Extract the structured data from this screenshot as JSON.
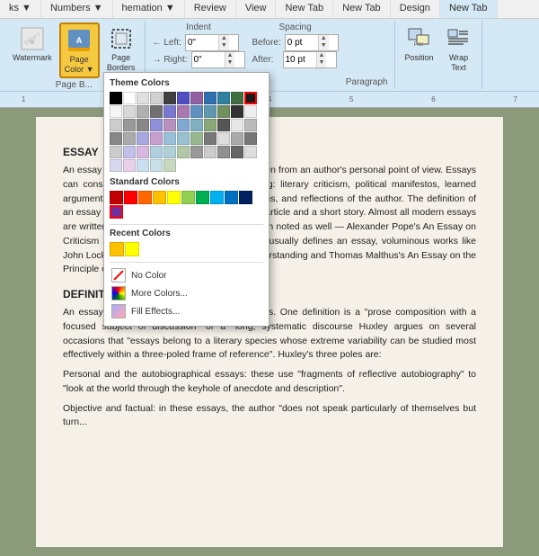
{
  "tabs": [
    "ks ▼",
    "Numbers ▼",
    "hemation ▼",
    "Review",
    "View",
    "New Tab",
    "New Tab",
    "Design",
    "New Tab"
  ],
  "ribbon": {
    "groups": {
      "page_bg": {
        "label": "Page B...",
        "buttons": [
          "Watermark",
          "Page\nColor",
          "Page\nBorders"
        ]
      },
      "paragraph": {
        "label": "Paragraph",
        "indent": {
          "label": "Indent",
          "left_label": "← Left:",
          "left_value": "0\"",
          "right_label": "→ Right:",
          "right_value": "0\""
        },
        "spacing": {
          "label": "Spacing",
          "before_label": "Before:",
          "before_value": "0 pt",
          "after_label": "After:",
          "after_value": "10 pt"
        }
      },
      "arrange": {
        "label": "",
        "position_label": "Position",
        "wrap_label": "Wrap\nText"
      }
    }
  },
  "color_dropdown": {
    "title": "Theme Colors",
    "theme_colors": [
      "#000000",
      "#ffffff",
      "#e0e0e0",
      "#d0d0d0",
      "#404040",
      "#5050c0",
      "#9060a0",
      "#3070b0",
      "#3080a0",
      "#407040",
      "#1a1a1a",
      "#f5f5f5",
      "#d8d8d8",
      "#b0b0b0",
      "#707070",
      "#7878d0",
      "#a878b0",
      "#6090c0",
      "#6098b0",
      "#709060",
      "#333333",
      "#eeeeee",
      "#cccccc",
      "#999999",
      "#888888",
      "#9090d8",
      "#b890c0",
      "#80a8d0",
      "#80b0c0",
      "#88a878",
      "#555555",
      "#e8e8e8",
      "#bbbbbb",
      "#888888",
      "#aaaaaa",
      "#a8a8e0",
      "#c8a0d0",
      "#98c0d8",
      "#98c0d0",
      "#98b890",
      "#777777",
      "#dddddd",
      "#aaaaaa",
      "#777777",
      "#cccccc",
      "#c0c0e8",
      "#d8b8e0",
      "#b0d0e0",
      "#b0d0d8",
      "#b0c8a8",
      "#999999",
      "#cccccc",
      "#909090",
      "#666666",
      "#dddddd",
      "#d8d8f0",
      "#e8d0e8",
      "#c8e0f0",
      "#c8e0e8",
      "#c8d8c0"
    ],
    "standard_title": "Standard Colors",
    "standard_colors": [
      "#c00000",
      "#ff0000",
      "#ff6600",
      "#ffc000",
      "#ffff00",
      "#92d050",
      "#00b050",
      "#00b0f0",
      "#0070c0",
      "#002060",
      "#7030a0"
    ],
    "recent_title": "Recent Colors",
    "recent_colors": [
      "#ffc000",
      "#ffff00"
    ],
    "options": [
      "No Color",
      "More Colors...",
      "Fill Effects..."
    ]
  },
  "document": {
    "essay_title": "ESSAY",
    "essay_p1": "An essay is a piece of writing which is often written from an author's personal point of view. Essays can consist of a number of elements, including: literary criticism, political manifestos, learned arguments, observations of daily life, recollections, and reflections of the author. The definition of an essay is vague, overlapping with those of an article and a short story. Almost all modern essays are written in prose, but works in verse have been noted as well — Alexander Pope's An Essay on Criticism and An Essay on Man). While brevity usually defines an essay, voluminous works like John Locke's An Essay Concerning Human Understanding and Thomas Malthus's An Essay on the Principle of Population are counterexamples.",
    "def_title": "DEFINITION",
    "def_p1": "An essay has been defined in a variety of ways. One definition is a \"prose composition with a focused subject of discussion\" or a \"long, systematic discourse Huxley argues on several occasions that \"essays belong to a literary species whose extreme variability can be studied most effectively within a three-poled frame of reference\". Huxley's three poles are:",
    "def_p2": "Personal and the autobiographical essays: these use \"fragments of reflective autobiography\" to \"look at the world through the keyhole of anecdote and description\".",
    "def_p3": "Objective and factual: in these essays, the author \"does not speak particularly of themselves but turn..."
  },
  "colors": {
    "ribbon_bg": "#d4e8f5",
    "active_btn": "#f5c842",
    "dropdown_border": "#aaa"
  }
}
